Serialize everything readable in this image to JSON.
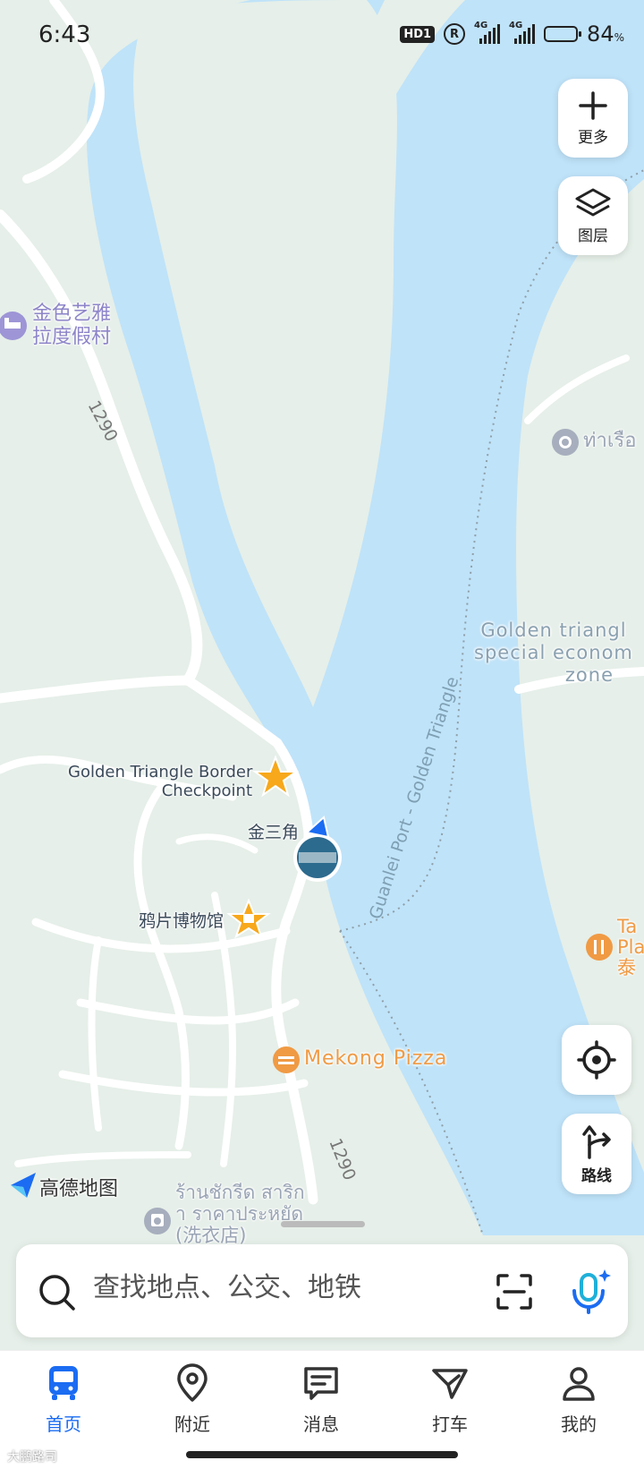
{
  "status_bar": {
    "time": "6:43",
    "hd_badge": "HD1",
    "network_1": "4G",
    "network_2": "4G",
    "battery_percent": "84",
    "percent_sign": "%",
    "battery_level": 0.84
  },
  "map_controls": {
    "more_label": "更多",
    "layers_label": "图层",
    "route_label": "路线"
  },
  "map": {
    "colors": {
      "water": "#bfe3f9",
      "land": "#e6efe9",
      "road": "#ffffff",
      "accent": "#1b6cf2"
    },
    "road_labels": [
      "1290",
      "1290"
    ],
    "river_label": "Guanlei Port - Golden Triangle",
    "brand": "高德地图",
    "pois": {
      "resort_line1": "金色艺雅",
      "resort_line2": "拉度假村",
      "pier": "ท่าเรือ",
      "sez_line1": "Golden triangl",
      "sez_line2": "special econom",
      "sez_line3": "zone",
      "border_line1": "Golden Triangle Border",
      "border_line2": "Checkpoint",
      "golden_triangle": "金三角",
      "opium_museum": "鸦片博物馆",
      "pizza": "Mekong Pizza",
      "right_poi_line1": "Ta",
      "right_poi_line2": "Pla",
      "right_poi_line3": "泰",
      "shop_line1": "ร้านชักรีด สาริก",
      "shop_line2": "า ราคาประหยัด",
      "shop_line3": "(洗衣店)"
    }
  },
  "search": {
    "placeholder": "查找地点、公交、地铁"
  },
  "tabs": [
    {
      "label": "首页",
      "icon": "bus-icon",
      "active": true
    },
    {
      "label": "附近",
      "icon": "location-pin-icon",
      "active": false
    },
    {
      "label": "消息",
      "icon": "message-icon",
      "active": false
    },
    {
      "label": "打车",
      "icon": "taxi-icon",
      "active": false
    },
    {
      "label": "我的",
      "icon": "person-icon",
      "active": false
    }
  ],
  "watermark": "大鹏路司"
}
